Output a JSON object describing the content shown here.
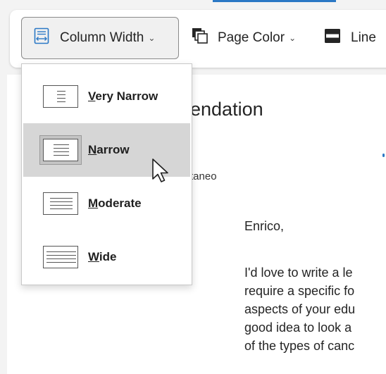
{
  "toolbar": {
    "column_width": {
      "label": "Column Width",
      "icon": "column-width-icon"
    },
    "page_color": {
      "label": "Page Color",
      "icon": "page-color-icon"
    },
    "line": {
      "label": "Line",
      "icon": "line-focus-icon"
    }
  },
  "document": {
    "heading": "endation",
    "subline": "taneo",
    "salutation": "Enrico,",
    "body_lines": [
      "I'd love to write a le",
      "require a specific fo",
      "aspects of your edu",
      "good idea to look a",
      "of the types of canc"
    ]
  },
  "menu": {
    "items": [
      {
        "accel": "V",
        "rest": "ery Narrow",
        "icon": "very-narrow-column-icon"
      },
      {
        "accel": "N",
        "rest": "arrow",
        "icon": "narrow-column-icon",
        "selected": true
      },
      {
        "accel": "M",
        "rest": "oderate",
        "icon": "moderate-column-icon"
      },
      {
        "accel": "W",
        "rest": "ide",
        "icon": "wide-column-icon"
      }
    ]
  },
  "colors": {
    "accent": "#2b78c5",
    "selected_bg": "#d6d6d6"
  }
}
